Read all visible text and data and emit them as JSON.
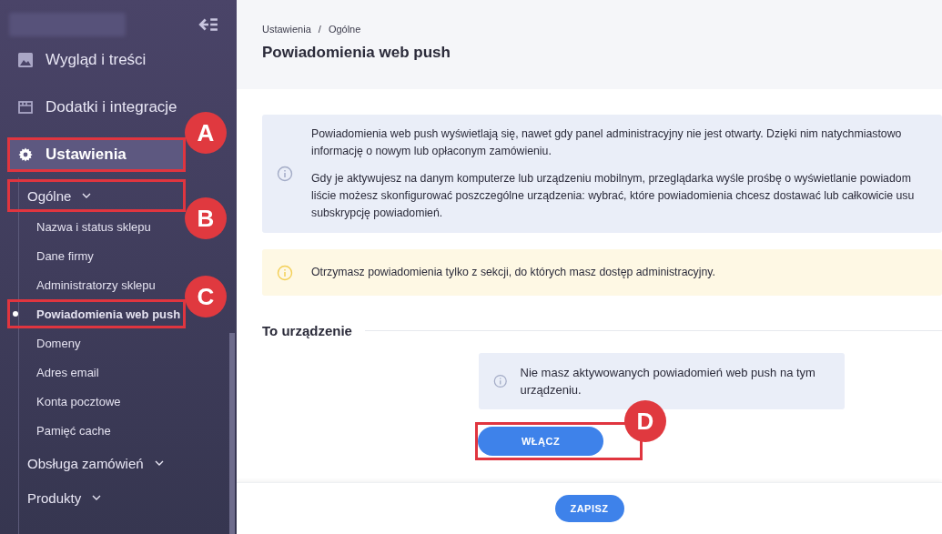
{
  "sidebar": {
    "items": [
      {
        "label": "Wygląd i treści",
        "selected": false
      },
      {
        "label": "Dodatki i integracje",
        "selected": false
      },
      {
        "label": "Ustawienia",
        "selected": true,
        "callout": "A",
        "children": [
          {
            "label": "Ogólne",
            "callout": "B",
            "children": [
              {
                "label": "Nazwa i status sklepu",
                "selected": false
              },
              {
                "label": "Dane firmy",
                "selected": false
              },
              {
                "label": "Administratorzy sklepu",
                "selected": false
              },
              {
                "label": "Powiadomienia web push",
                "selected": true,
                "callout": "C"
              },
              {
                "label": "Domeny",
                "selected": false
              },
              {
                "label": "Adres email",
                "selected": false
              },
              {
                "label": "Konta pocztowe",
                "selected": false
              },
              {
                "label": "Pamięć cache",
                "selected": false
              }
            ]
          },
          {
            "label": "Obsługa zamówień"
          },
          {
            "label": "Produkty"
          }
        ]
      }
    ]
  },
  "breadcrumb": [
    "Ustawienia",
    "Ogólne"
  ],
  "breadcrumb_separator": "/",
  "page_title": "Powiadomienia web push",
  "alerts": [
    {
      "kind": "info",
      "paragraphs": [
        [
          "Powiadomienia web push wyświetlają się, nawet gdy panel administracyjny nie jest otwarty. Dzięki nim natychmiastowo",
          "informację o nowym lub opłaconym zamówieniu."
        ],
        [
          "Gdy je aktywujesz na danym komputerze lub urządzeniu mobilnym, przeglądarka wyśle prośbę o wyświetlanie powiadom",
          "liście możesz skonfigurować poszczególne urządzenia: wybrać, które powiadomienia chcesz dostawać lub całkowicie usu",
          "subskrypcję powiadomień."
        ]
      ]
    },
    {
      "kind": "warning",
      "paragraphs": [
        [
          "Otrzymasz powiadomienia tylko z sekcji, do których masz dostęp administracyjny."
        ]
      ]
    }
  ],
  "section": {
    "title": "To urządzenie",
    "notice": "Nie masz aktywowanych powiadomień web push na tym urządzeniu.",
    "button": {
      "label": "WŁĄCZ",
      "callout": "D"
    }
  },
  "footer": {
    "button": "ZAPISZ"
  }
}
